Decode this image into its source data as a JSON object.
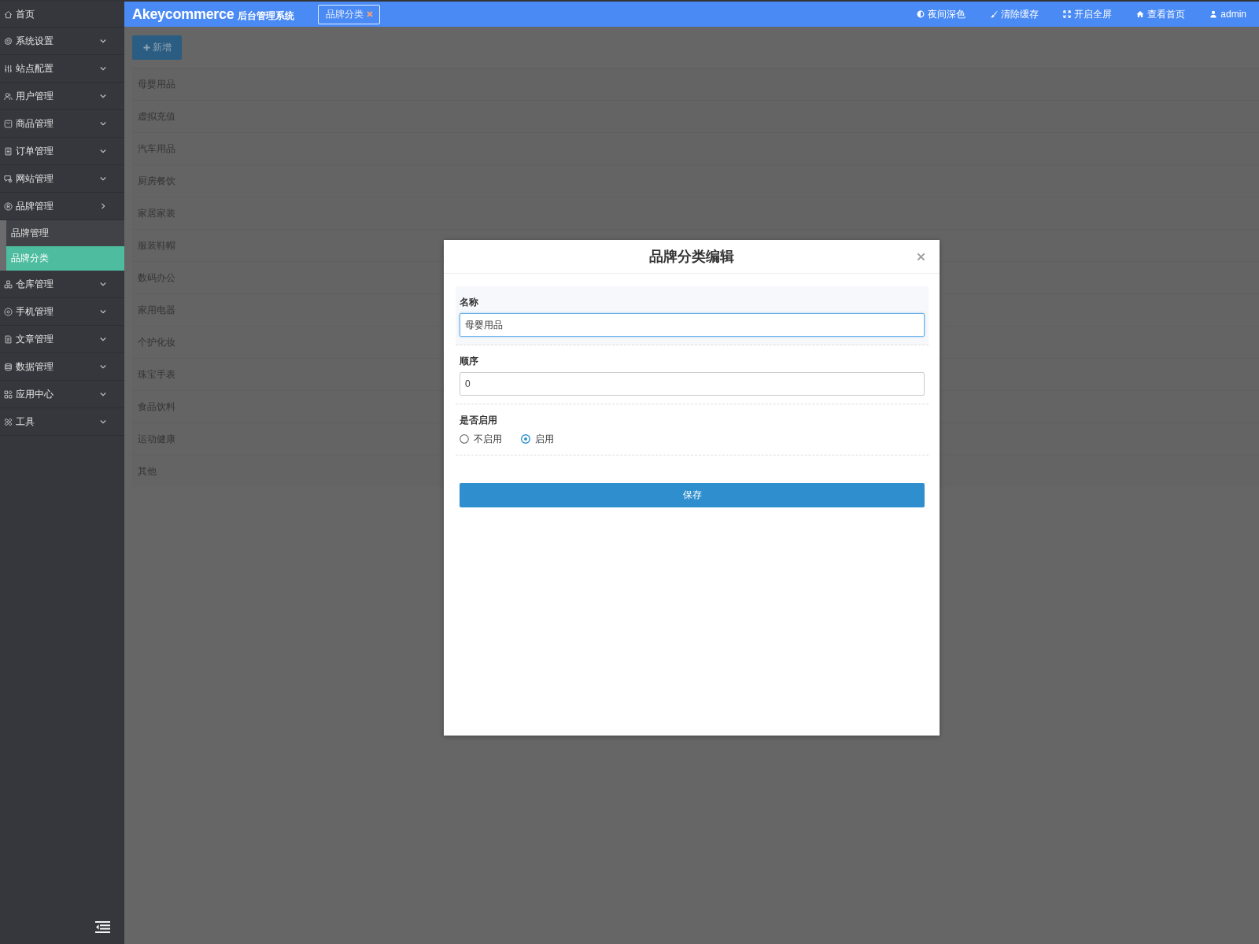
{
  "sidebar": {
    "home": {
      "label": "首页"
    },
    "groups": [
      {
        "label": "系统设置",
        "expanded": false
      },
      {
        "label": "站点配置",
        "expanded": false
      },
      {
        "label": "用户管理",
        "expanded": false
      },
      {
        "label": "商品管理",
        "expanded": false
      },
      {
        "label": "订单管理",
        "expanded": false
      },
      {
        "label": "网站管理",
        "expanded": false
      },
      {
        "label": "品牌管理",
        "expanded": true,
        "children": [
          {
            "label": "品牌管理",
            "selected": false
          },
          {
            "label": "品牌分类",
            "selected": true
          }
        ]
      },
      {
        "label": "仓库管理",
        "expanded": false
      },
      {
        "label": "手机管理",
        "expanded": false
      },
      {
        "label": "文章管理",
        "expanded": false
      },
      {
        "label": "数据管理",
        "expanded": false
      },
      {
        "label": "应用中心",
        "expanded": false
      },
      {
        "label": "工具",
        "expanded": false
      }
    ]
  },
  "top_bar": {
    "logo": "Akeycommerce",
    "subtitle": "后台管理系统",
    "tabs": [
      {
        "label": "品牌分类",
        "selected": true
      }
    ],
    "actions": [
      {
        "label": "夜间深色"
      },
      {
        "label": "清除缓存"
      },
      {
        "label": "开启全屏"
      },
      {
        "label": "查看首页"
      },
      {
        "label": "admin"
      }
    ]
  },
  "content": {
    "add_button": "新增",
    "rows": [
      "母婴用品",
      "虚拟充值",
      "汽车用品",
      "厨房餐饮",
      "家居家装",
      "服装鞋帽",
      "数码办公",
      "家用电器",
      "个护化妆",
      "珠宝手表",
      "食品饮料",
      "运动健康",
      "其他"
    ]
  },
  "modal": {
    "title": "品牌分类编辑",
    "fields": [
      {
        "kind": "text",
        "label": "名称",
        "value": "母婴用品",
        "focused": true
      },
      {
        "kind": "text",
        "label": "顺序",
        "value": "0",
        "focused": false
      },
      {
        "kind": "radio",
        "label": "是否启用",
        "focused": false,
        "options": [
          {
            "label": "不启用",
            "selected": false
          },
          {
            "label": "启用",
            "selected": true
          }
        ]
      }
    ],
    "save_button": "保存"
  }
}
